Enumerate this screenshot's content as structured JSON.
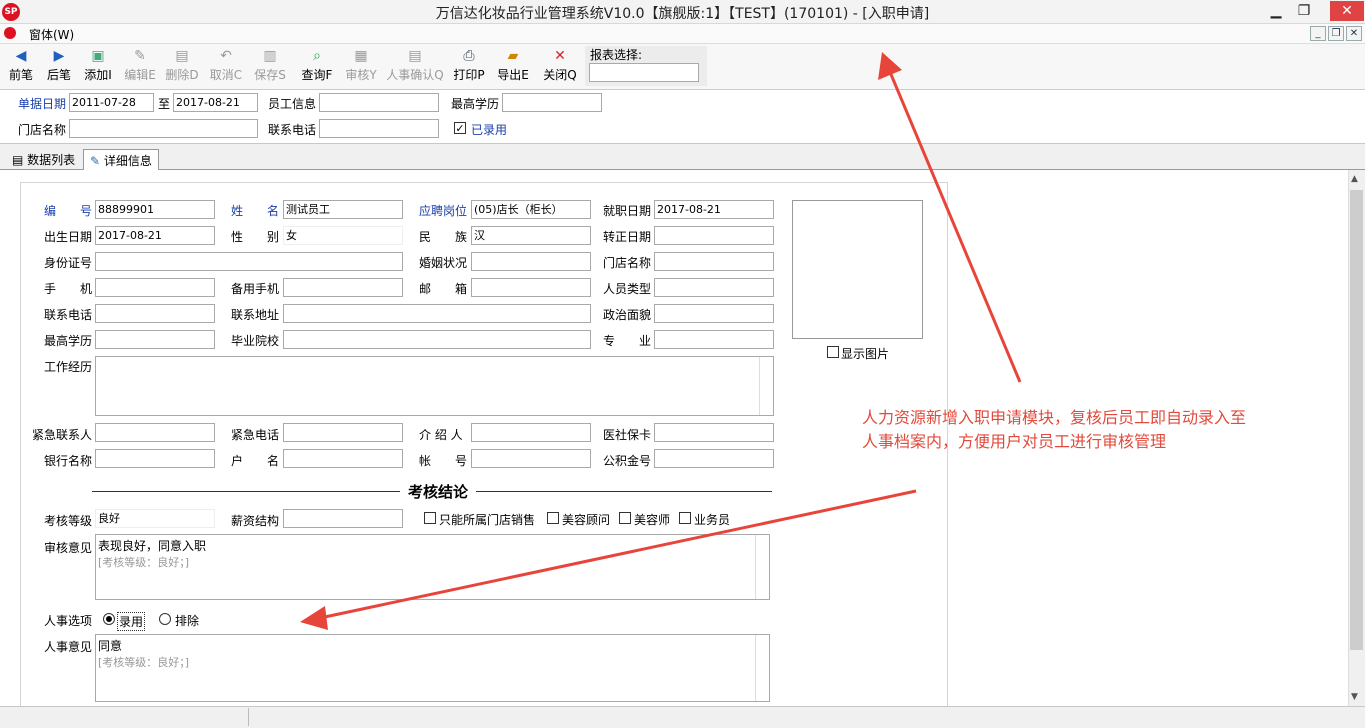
{
  "window": {
    "title": "万信达化妆品行业管理系统V10.0【旗舰版:1】【TEST】(170101) - [入职申请]",
    "logo": "SP",
    "minimize": "▁",
    "restore": "❐",
    "close": "✕"
  },
  "menu": {
    "window_label": "窗体(W)",
    "mdi": [
      "_",
      "❐",
      "✕"
    ]
  },
  "toolbar": {
    "buttons": [
      {
        "label": "前笔",
        "icon": "◀"
      },
      {
        "label": "后笔",
        "icon": "▶"
      },
      {
        "label": "添加I",
        "icon": "▣"
      },
      {
        "label": "编辑E",
        "icon": "✎"
      },
      {
        "label": "删除D",
        "icon": "▤"
      },
      {
        "label": "取消C",
        "icon": "↶"
      },
      {
        "label": "保存S",
        "icon": "▥"
      },
      {
        "label": "查询F",
        "icon": "⌕"
      },
      {
        "label": "审核Y",
        "icon": "▦"
      },
      {
        "label": "人事确认Q",
        "icon": "▤"
      },
      {
        "label": "打印P",
        "icon": "⎙"
      },
      {
        "label": "导出E",
        "icon": "▰"
      },
      {
        "label": "关闭Q",
        "icon": "✕"
      }
    ],
    "report_label": "报表选择:",
    "report_value": ""
  },
  "filter": {
    "date_label": "单据日期",
    "date_from": "2011-07-28",
    "to_label": "至",
    "date_to": "2017-08-21",
    "employee_label": "员工信息",
    "employee_value": "",
    "edu_label": "最高学历",
    "edu_value": "",
    "store_label": "门店名称",
    "store_value": "",
    "phone_label": "联系电话",
    "phone_value": "",
    "hired_label": "已录用"
  },
  "tabs": [
    {
      "label": "数据列表"
    },
    {
      "label": "详细信息"
    }
  ],
  "form": {
    "no_label": "编　　号",
    "no": "88899901",
    "name_label": "姓　　名",
    "name": "测试员工",
    "post_label": "应聘岗位",
    "post": "(05)店长（柜长）",
    "entry_label": "就职日期",
    "entry": "2017-08-21",
    "birth_label": "出生日期",
    "birth": "2017-08-21",
    "sex_label": "性　　别",
    "sex": "女",
    "nation_label": "民　　族",
    "nation": "汉",
    "regular_label": "转正日期",
    "regular": "",
    "idcard_label": "身份证号",
    "idcard": "",
    "marital_label": "婚姻状况",
    "marital": "",
    "store_label": "门店名称",
    "store": "",
    "mobile_label": "手　　机",
    "mobile": "",
    "mobile2_label": "备用手机",
    "mobile2": "",
    "mail_label": "邮　　箱",
    "mail": "",
    "ptype_label": "人员类型",
    "ptype": "",
    "tel_label": "联系电话",
    "tel": "",
    "addr_label": "联系地址",
    "addr": "",
    "political_label": "政治面貌",
    "political": "",
    "edu_label": "最高学历",
    "edu": "",
    "school_label": "毕业院校",
    "school": "",
    "major_label": "专　　业",
    "major": "",
    "work_label": "工作经历",
    "work": "",
    "emg_label": "紧急联系人",
    "emg": "",
    "emgtel_label": "紧急电话",
    "emgtel": "",
    "ref_label": "介 绍 人",
    "ref": "",
    "social_label": "医社保卡",
    "social": "",
    "bank_label": "银行名称",
    "bank": "",
    "holder_label": "户　　名",
    "holder": "",
    "acct_label": "帐　　号",
    "acct": "",
    "fund_label": "公积金号",
    "fund": "",
    "photo_label": "显示图片",
    "section_title": "考核结论",
    "grade_label": "考核等级",
    "grade": "良好",
    "salary_label": "薪资结构",
    "salary": "",
    "opt1": "只能所属门店销售",
    "opt2": "美容顾问",
    "opt3": "美容师",
    "opt4": "业务员",
    "review_label": "审核意见",
    "review": "表现良好，同意入职",
    "review_hint": "[考核等级：良好；]",
    "hr_opt_label": "人事选项",
    "hr_opt1": "录用",
    "hr_opt2": "排除",
    "hr_label": "人事意见",
    "hr": "同意",
    "hr_hint": "[考核等级：良好；]"
  },
  "annotation": {
    "line1": "人力资源新增入职申请模块，复核后员工即自动录入至",
    "line2": "人事档案内，方便用户对员工进行审核管理"
  },
  "colors": {
    "accent": "#e24a3c",
    "label_blue": "#1a3fa8"
  }
}
